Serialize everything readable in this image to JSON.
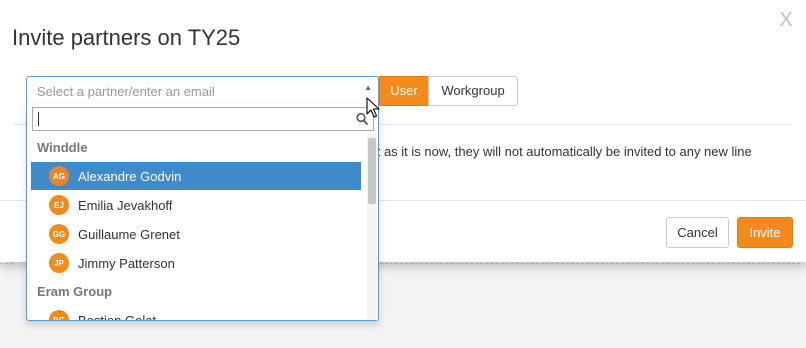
{
  "dialog": {
    "title": "Invite partners on TY25",
    "close_glyph": "X"
  },
  "partner_select": {
    "placeholder": "Select a partner/enter an email",
    "arrow_icon": "caret-up-icon"
  },
  "toggle": {
    "user_label": "User",
    "workgroup_label": "Workgroup",
    "active": "User"
  },
  "info_text": "ect as it is now, they will not automatically be invited to any new line",
  "dropdown": {
    "search_value": "",
    "groups": [
      {
        "label": "Winddle",
        "options": [
          {
            "initials": "AG",
            "name": "Alexandre Godvin",
            "selected": true
          },
          {
            "initials": "EJ",
            "name": "Emilia Jevakhoff",
            "selected": false
          },
          {
            "initials": "GG",
            "name": "Guillaume Grenet",
            "selected": false
          },
          {
            "initials": "JP",
            "name": "Jimmy Patterson",
            "selected": false
          }
        ]
      },
      {
        "label": "Eram Group",
        "options": [
          {
            "initials": "BG",
            "name": "Bastien Golat",
            "selected": false
          }
        ]
      }
    ]
  },
  "footer": {
    "cancel_label": "Cancel",
    "invite_label": "Invite"
  },
  "colors": {
    "accent": "#f28a1c",
    "selection": "#3f8bc9",
    "focus_border": "#5b9bd5"
  }
}
